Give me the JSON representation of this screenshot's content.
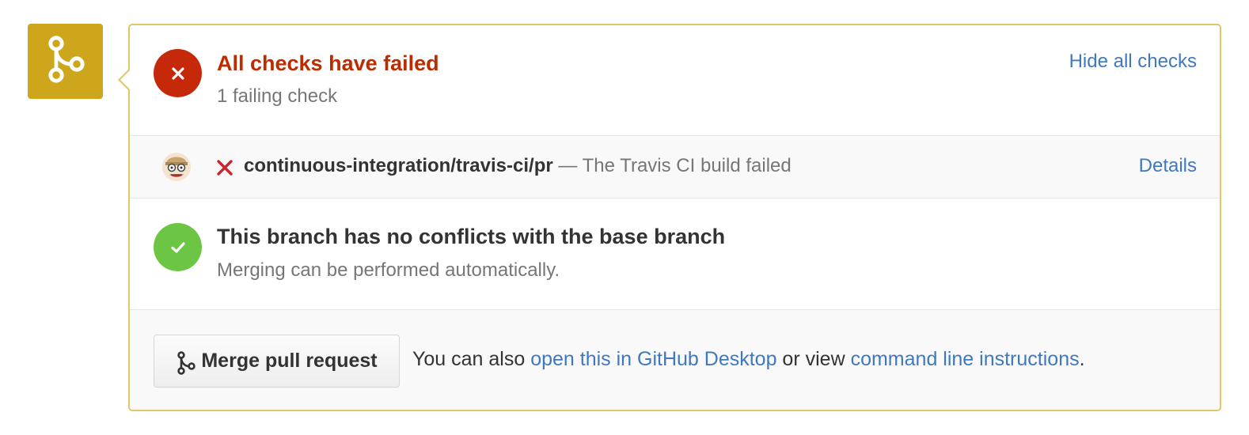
{
  "merge_icon": "git-merge-icon",
  "checks": {
    "title": "All checks have failed",
    "subtitle": "1 failing check",
    "hide_label": "Hide all checks",
    "status_icon": "x-icon",
    "status_color": "#c6290a"
  },
  "travis": {
    "avatar_icon": "travis-ci-avatar",
    "status_icon": "x-icon",
    "context": "continuous-integration/travis-ci/pr",
    "separator": " — ",
    "description": "The Travis CI build failed",
    "details_label": "Details"
  },
  "conflicts": {
    "title": "This branch has no conflicts with the base branch",
    "subtitle": "Merging can be performed automatically.",
    "status_icon": "check-icon",
    "status_color": "#6cc644"
  },
  "merge": {
    "button_label": "Merge pull request",
    "help_prefix": "You can also ",
    "desktop_link": "open this in GitHub Desktop",
    "help_middle": " or view ",
    "cli_link": "command line instructions",
    "help_suffix": "."
  },
  "colors": {
    "badge": "#cea61b",
    "panel_border": "#e2c66a",
    "link": "#4078c0",
    "fail_text": "#bd2c00"
  }
}
